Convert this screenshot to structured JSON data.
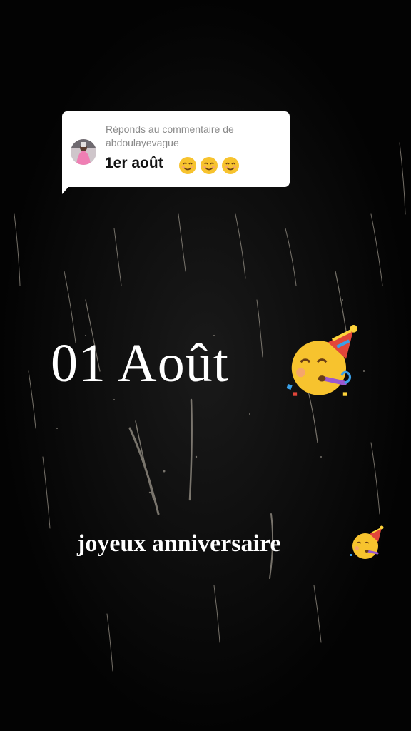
{
  "reply": {
    "label_line1": "Réponds au commentaire de",
    "label_line2": "abdoulayevague",
    "comment_text": "1er août",
    "comment_emojis": [
      "smiling-face-icon",
      "smiling-face-icon",
      "smiling-face-icon"
    ]
  },
  "overlay": {
    "date_text": "01 Août",
    "date_emoji": "partying-face-icon",
    "wish_text": "joyeux anniversaire",
    "wish_emoji": "partying-face-icon"
  },
  "colors": {
    "background": "#030303",
    "bubble": "#ffffff",
    "emoji_yellow": "#f7c32e",
    "party_hat": "#e2463a"
  }
}
